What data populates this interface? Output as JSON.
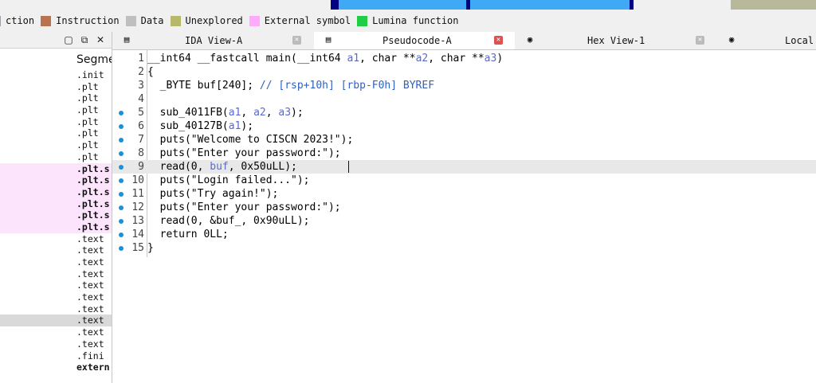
{
  "nav_colors": {
    "bg": "#f0f0f0",
    "dark": "#000080",
    "blue": "#3fa9f5",
    "olive": "#b8b89a"
  },
  "legend": {
    "items": [
      {
        "label": "ction",
        "color": "#9aa0a6"
      },
      {
        "label": "Instruction",
        "color": "#b87350"
      },
      {
        "label": "Data",
        "color": "#bfbfbf"
      },
      {
        "label": "Unexplored",
        "color": "#b8b86a"
      },
      {
        "label": "External symbol",
        "color": "#ffaaff"
      },
      {
        "label": "Lumina function",
        "color": "#22cc44"
      }
    ]
  },
  "segments_panel": {
    "column_header": "Segme",
    "rows": [
      {
        "text": ".init",
        "style": ""
      },
      {
        "text": ".plt",
        "style": ""
      },
      {
        "text": ".plt",
        "style": ""
      },
      {
        "text": ".plt",
        "style": ""
      },
      {
        "text": ".plt",
        "style": ""
      },
      {
        "text": ".plt",
        "style": ""
      },
      {
        "text": ".plt",
        "style": ""
      },
      {
        "text": ".plt",
        "style": ""
      },
      {
        "text": ".plt.s",
        "style": "ext"
      },
      {
        "text": ".plt.s",
        "style": "ext"
      },
      {
        "text": ".plt.s",
        "style": "ext"
      },
      {
        "text": ".plt.s",
        "style": "ext"
      },
      {
        "text": ".plt.s",
        "style": "ext"
      },
      {
        "text": ".plt.s",
        "style": "ext"
      },
      {
        "text": ".text",
        "style": ""
      },
      {
        "text": ".text",
        "style": ""
      },
      {
        "text": ".text",
        "style": ""
      },
      {
        "text": ".text",
        "style": ""
      },
      {
        "text": ".text",
        "style": ""
      },
      {
        "text": ".text",
        "style": ""
      },
      {
        "text": ".text",
        "style": ""
      },
      {
        "text": ".text",
        "style": "sel"
      },
      {
        "text": ".text",
        "style": ""
      },
      {
        "text": ".text",
        "style": ""
      },
      {
        "text": ".fini",
        "style": ""
      },
      {
        "text": "extern",
        "style": "bold"
      }
    ]
  },
  "tabs": [
    {
      "label": "IDA View-A",
      "icon": "ida-view-icon"
    },
    {
      "label": "Pseudocode-A",
      "icon": "pseudocode-icon"
    },
    {
      "label": "Hex View-1",
      "icon": "hex-view-icon"
    },
    {
      "label": "Local",
      "icon": "local-types-icon"
    }
  ],
  "code": {
    "lines": [
      {
        "n": "1",
        "dot": false,
        "text": "__int64 __fastcall main(__int64 a1, char **a2, char **a3)"
      },
      {
        "n": "2",
        "dot": false,
        "text": "{"
      },
      {
        "n": "3",
        "dot": false,
        "text": "  _BYTE buf[240]; // [rsp+10h] [rbp-F0h] BYREF"
      },
      {
        "n": "4",
        "dot": false,
        "text": ""
      },
      {
        "n": "5",
        "dot": true,
        "text": "  sub_4011FB(a1, a2, a3);"
      },
      {
        "n": "6",
        "dot": true,
        "text": "  sub_40127B(a1);"
      },
      {
        "n": "7",
        "dot": true,
        "text": "  puts(\"Welcome to CISCN 2023!\");"
      },
      {
        "n": "8",
        "dot": true,
        "text": "  puts(\"Enter your password:\");"
      },
      {
        "n": "9",
        "dot": true,
        "text": "  read(0, buf, 0x50uLL);"
      },
      {
        "n": "10",
        "dot": true,
        "text": "  puts(\"Login failed...\");"
      },
      {
        "n": "11",
        "dot": true,
        "text": "  puts(\"Try again!\");"
      },
      {
        "n": "12",
        "dot": true,
        "text": "  puts(\"Enter your password:\");"
      },
      {
        "n": "13",
        "dot": true,
        "text": "  read(0, &buf_, 0x90uLL);"
      },
      {
        "n": "14",
        "dot": true,
        "text": "  return 0LL;"
      },
      {
        "n": "15",
        "dot": true,
        "text": "}"
      }
    ]
  }
}
